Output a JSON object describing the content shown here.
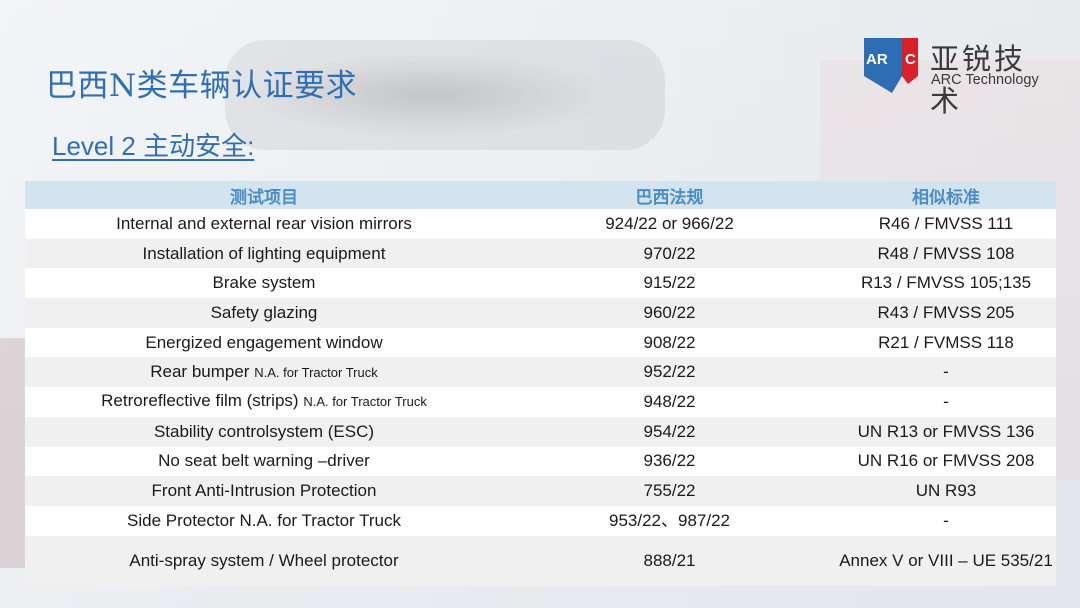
{
  "slide": {
    "title": "巴西N类车辆认证要求",
    "subtitle": "Level 2 主动安全:"
  },
  "logo": {
    "mark_text": "ARC",
    "name_cn": "亚锐技术",
    "name_en": "ARC Technology"
  },
  "table": {
    "headers": [
      "测试项目",
      "巴西法规",
      "相似标准"
    ],
    "rows": [
      {
        "item": "Internal and external rear vision mirrors",
        "note": "",
        "regulation": "924/22 or 966/22",
        "standard": "R46 / FMVSS 111"
      },
      {
        "item": "Installation of lighting equipment",
        "note": "",
        "regulation": "970/22",
        "standard": "R48 / FMVSS 108"
      },
      {
        "item": "Brake system",
        "note": "",
        "regulation": "915/22",
        "standard": "R13 / FMVSS 105;135"
      },
      {
        "item": "Safety glazing",
        "note": "",
        "regulation": "960/22",
        "standard": "R43 / FMVSS 205"
      },
      {
        "item": "Energized engagement window",
        "note": "",
        "regulation": "908/22",
        "standard": "R21 / FVMSS 118"
      },
      {
        "item": "Rear bumper",
        "note": "N.A. for Tractor Truck",
        "regulation": "952/22",
        "standard": "-"
      },
      {
        "item": "Retroreflective film (strips)",
        "note": "N.A. for Tractor Truck",
        "regulation": "948/22",
        "standard": "-"
      },
      {
        "item": "Stability controlsystem (ESC)",
        "note": "",
        "regulation": "954/22",
        "standard": "UN R13 or FMVSS 136"
      },
      {
        "item": "No seat belt warning –driver",
        "note": "",
        "regulation": "936/22",
        "standard": "UN R16 or FMVSS 208"
      },
      {
        "item": "Front Anti-Intrusion Protection",
        "note": "",
        "regulation": "755/22",
        "standard": "UN R93"
      },
      {
        "item": "Side Protector N.A. for Tractor Truck",
        "note": "",
        "regulation": "953/22、987/22",
        "standard": "-"
      },
      {
        "item": "Anti-spray system / Wheel protector",
        "note": "",
        "regulation": "888/21",
        "standard": "Annex V or VIII – UE 535/21"
      }
    ]
  },
  "colors": {
    "title": "#2f6fb4",
    "header_bg": "#d3e4ef",
    "header_text": "#4a8dc3",
    "logo_blue": "#2e6db3",
    "logo_red": "#d6222b"
  }
}
